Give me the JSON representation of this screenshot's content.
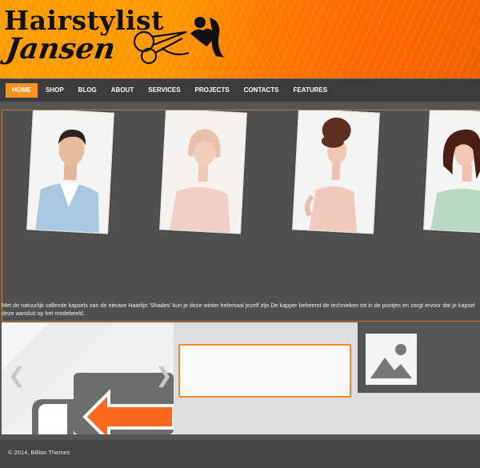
{
  "header": {
    "logo_line1": "Hairstylist",
    "logo_line2": "Jansen",
    "accent": "#ff9a00"
  },
  "nav": {
    "items": [
      {
        "label": "HOME",
        "active": true
      },
      {
        "label": "SHOP"
      },
      {
        "label": "BLOG"
      },
      {
        "label": "ABOUT"
      },
      {
        "label": "SERVICES"
      },
      {
        "label": "PROJECTS"
      },
      {
        "label": "CONTACTS"
      },
      {
        "label": "FEATURES"
      }
    ]
  },
  "slider": {
    "caption": "Met de natuurlijk vallende kapsels van de nieuwe Haarlijn 'Shades' kun je deze winter helemaal jezelf zijn.De kapper beheerst de technieken tot in de puntjes en zorgt ervoor dat je kapsel deze aansluit op het modebeeld."
  },
  "carousel": {
    "prev_icon": "chevron-left-icon",
    "next_icon": "chevron-right-icon"
  },
  "footer": {
    "copyright": "© 2014, Billion Themes"
  }
}
